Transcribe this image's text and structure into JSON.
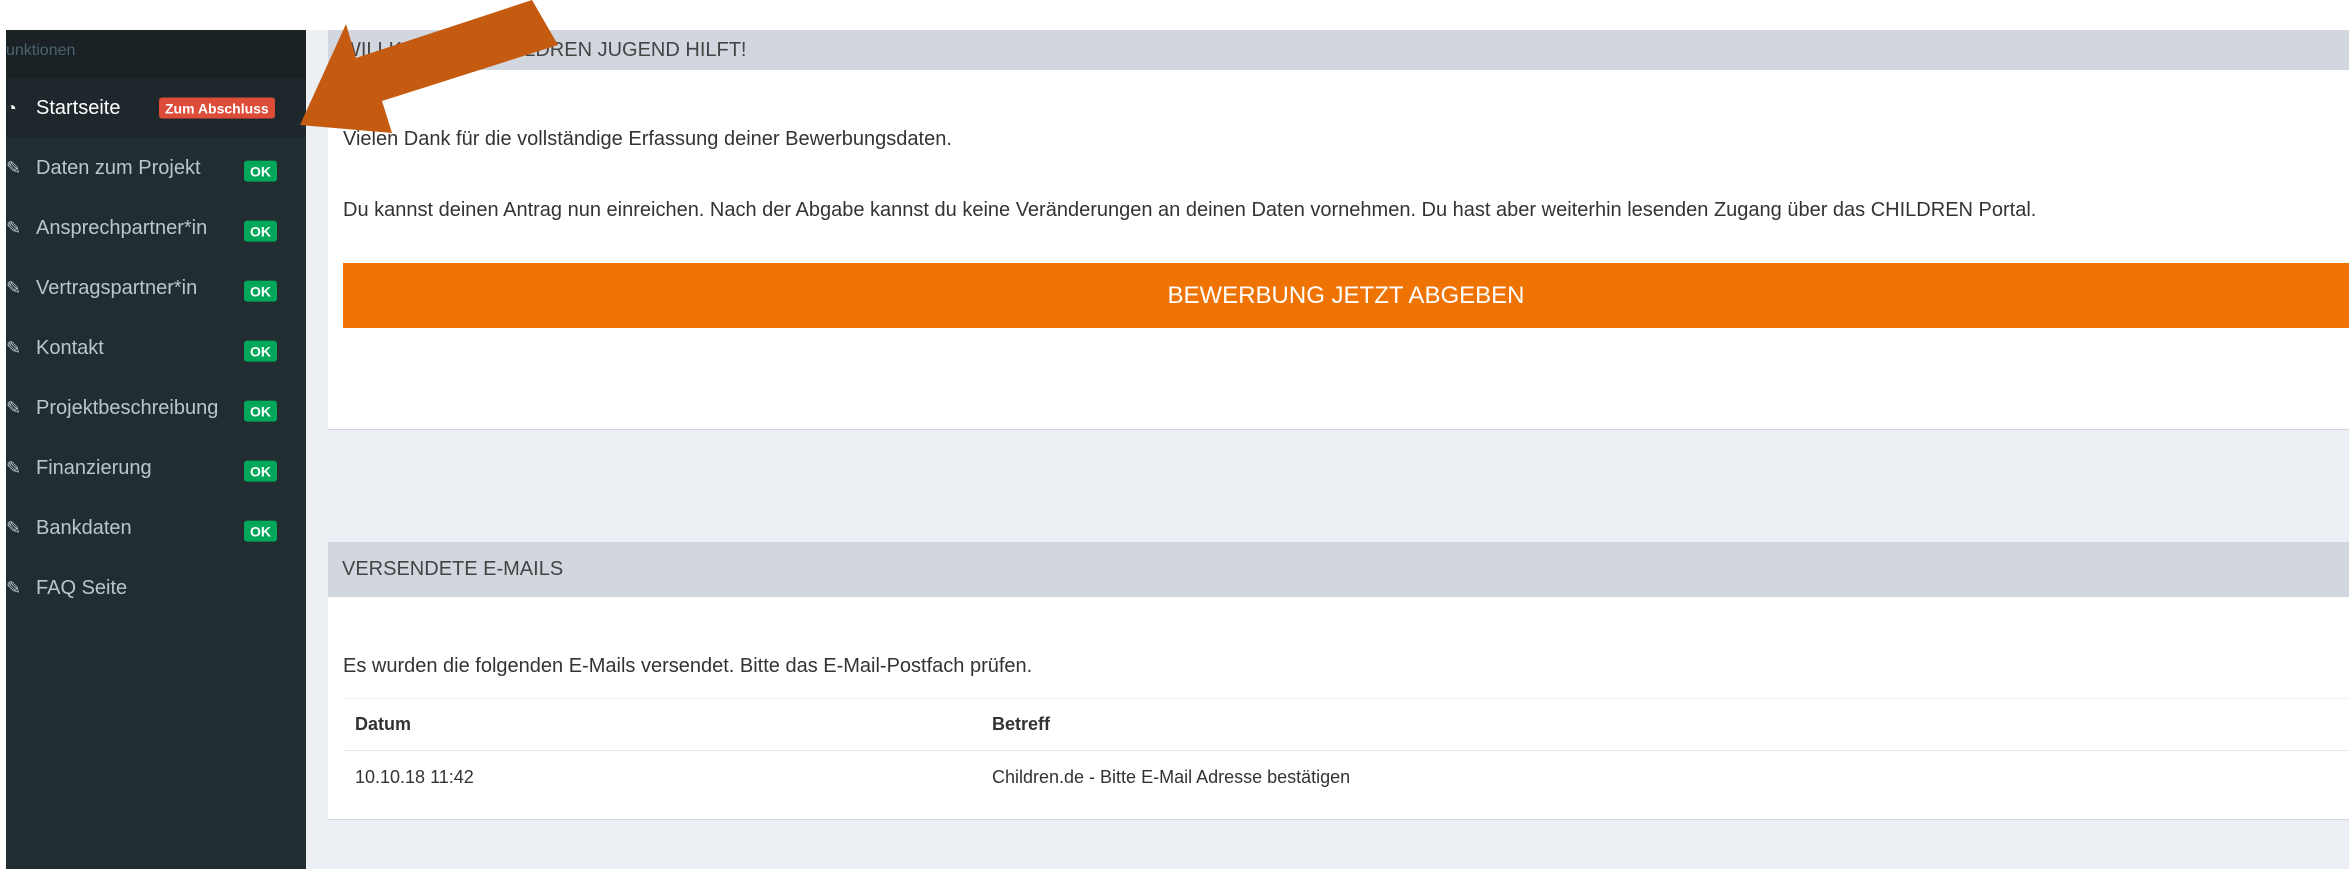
{
  "sidebar": {
    "header": "unktionen",
    "items": [
      {
        "icon": "dashboard-icon",
        "glyph": "◔",
        "label": "Startseite",
        "badge": "Zum Abschluss",
        "active": true
      },
      {
        "icon": "edit-icon",
        "glyph": "✎",
        "label": "Daten zum Projekt",
        "badge": "OK"
      },
      {
        "icon": "edit-icon",
        "glyph": "✎",
        "label": "Ansprechpartner*in",
        "badge": "OK"
      },
      {
        "icon": "edit-icon",
        "glyph": "✎",
        "label": "Vertragspartner*in",
        "badge": "OK"
      },
      {
        "icon": "edit-icon",
        "glyph": "✎",
        "label": "Kontakt",
        "badge": "OK"
      },
      {
        "icon": "edit-icon",
        "glyph": "✎",
        "label": "Projektbeschreibung",
        "badge": "OK"
      },
      {
        "icon": "edit-icon",
        "glyph": "✎",
        "label": "Finanzierung",
        "badge": "OK"
      },
      {
        "icon": "edit-icon",
        "glyph": "✎",
        "label": "Bankdaten",
        "badge": "OK"
      },
      {
        "icon": "edit-icon",
        "glyph": "✎",
        "label": "FAQ Seite"
      }
    ]
  },
  "welcome_box": {
    "title": "WILLKOMMEN! CHILDREN JUGEND HILFT!",
    "thanks_text": "Vielen Dank für die vollständige Erfassung deiner Bewerbungsdaten.",
    "info_text": "Du kannst deinen Antrag nun einreichen. Nach der Abgabe kannst du keine Veränderungen an deinen Daten vornehmen. Du hast aber weiterhin lesenden Zugang über das CHILDREN Portal.",
    "submit_label": "BEWERBUNG JETZT ABGEBEN"
  },
  "emails_box": {
    "title": "VERSENDETE E-MAILS",
    "info_text": "Es wurden die folgenden E-Mails versendet. Bitte das E-Mail-Postfach prüfen.",
    "columns": [
      "Datum",
      "Betreff"
    ],
    "rows": [
      {
        "date": "10.10.18 11:42",
        "subject": "Children.de - Bitte E-Mail Adresse bestätigen"
      }
    ]
  },
  "colors": {
    "sidebar_bg": "#222d32",
    "accent_orange": "#ee7303",
    "ok_green": "#00a65a",
    "badge_red": "#dd4b39",
    "annotation_arrow": "#c55a11"
  }
}
